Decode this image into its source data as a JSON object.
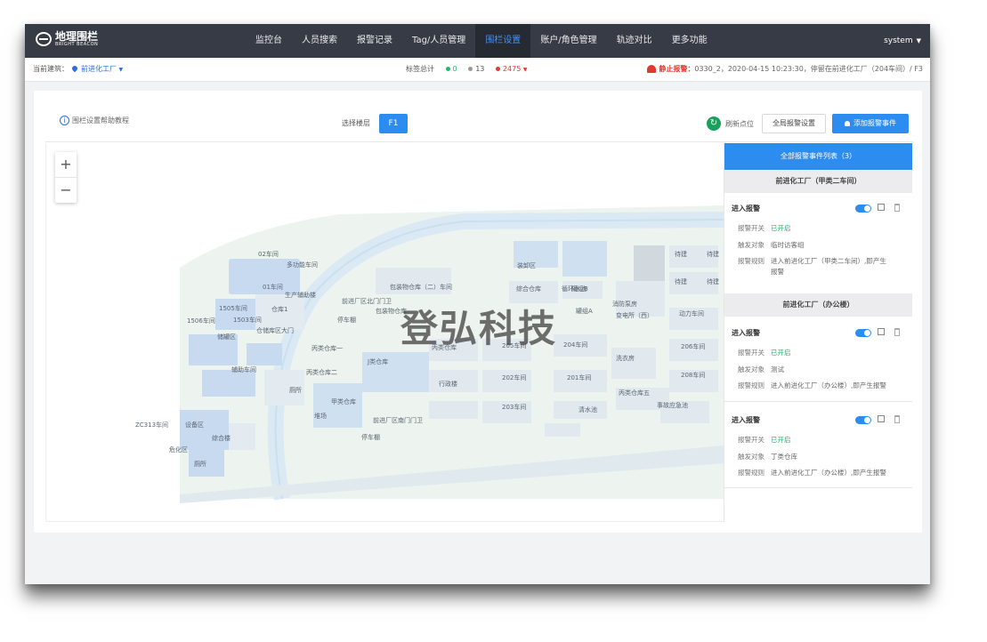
{
  "brand": {
    "name": "地理围栏",
    "sub": "BRIGHT BEACON"
  },
  "nav": {
    "items": [
      "监控台",
      "人员搜索",
      "报警记录",
      "Tag/人员管理",
      "围栏设置",
      "账户/角色管理",
      "轨迹对比",
      "更多功能"
    ],
    "active_index": 4,
    "user": "system"
  },
  "subbar": {
    "current_site_label": "当前建筑：",
    "current_site": "前进化工厂",
    "stats_label": "标签总计",
    "stats": [
      {
        "color": "#19be6b",
        "value": "0"
      },
      {
        "color": "#999999",
        "value": "13"
      },
      {
        "color": "#e23b2e",
        "value": "2475"
      }
    ],
    "alert_label": "静止报警：",
    "alert_text": "0330_2，2020-04-15 10:23:30，停留在前进化工厂（204车间）/ F3"
  },
  "toolbar": {
    "help_text": "围栏设置帮助教程",
    "floor_label": "选择楼层",
    "floor_value": "F1",
    "refresh_label": "刷新点位",
    "global_btn": "全局报警设置",
    "add_btn": "添加报警事件"
  },
  "map": {
    "watermark": "登弘科技",
    "labels": [
      "02车间",
      "多功能车间",
      "01车间",
      "生产辅助楼",
      "1505车间",
      "1503车间",
      "1506车间",
      "仓库1",
      "储罐区",
      "仓储库区大门",
      "丙类仓库一",
      "丙类仓库二",
      "辅助车间",
      "厕所",
      "堆场",
      "ZC313车间",
      "设备区",
      "综合楼",
      "危化区",
      "厕所",
      "前进厂区北门门卫",
      "包装物仓库",
      "停车棚",
      "J类仓库",
      "丙类仓库",
      "205车间",
      "202车间",
      "203车间",
      "204车间",
      "201车间",
      "行政楼",
      "甲类仓库",
      "前进厂区南门门卫",
      "停车棚",
      "清水池",
      "丙类仓库五",
      "事故应急池",
      "洗衣房",
      "循环水池",
      "消防泵房",
      "变电所（西）",
      "动力车间",
      "206车间",
      "208车间",
      "待建",
      "待建",
      "待建",
      "待建",
      "装卸区",
      "罐组B",
      "罐组A",
      "包装物仓库（二）车间",
      "综合仓库"
    ]
  },
  "panel": {
    "header": "全部报警事件列表（3）",
    "groups": [
      {
        "title": "前进化工厂（甲类二车间）",
        "rules": [
          {
            "title": "进入报警",
            "switch_key": "报警开关",
            "switch_val": "已开启",
            "target_key": "触发对象",
            "target_val": "临时访客组",
            "rule_key": "报警规则",
            "rule_val": "进入前进化工厂（甲类二车间）,即产生报警"
          }
        ]
      },
      {
        "title": "前进化工厂（办公楼）",
        "rules": [
          {
            "title": "进入报警",
            "switch_key": "报警开关",
            "switch_val": "已开启",
            "target_key": "触发对象",
            "target_val": "测试",
            "rule_key": "报警规则",
            "rule_val": "进入前进化工厂（办公楼）,即产生报警"
          },
          {
            "title": "进入报警",
            "switch_key": "报警开关",
            "switch_val": "已开启",
            "target_key": "触发对象",
            "target_val": "丁类仓库",
            "rule_key": "报警规则",
            "rule_val": "进入前进化工厂（办公楼）,即产生报警"
          }
        ]
      }
    ]
  }
}
